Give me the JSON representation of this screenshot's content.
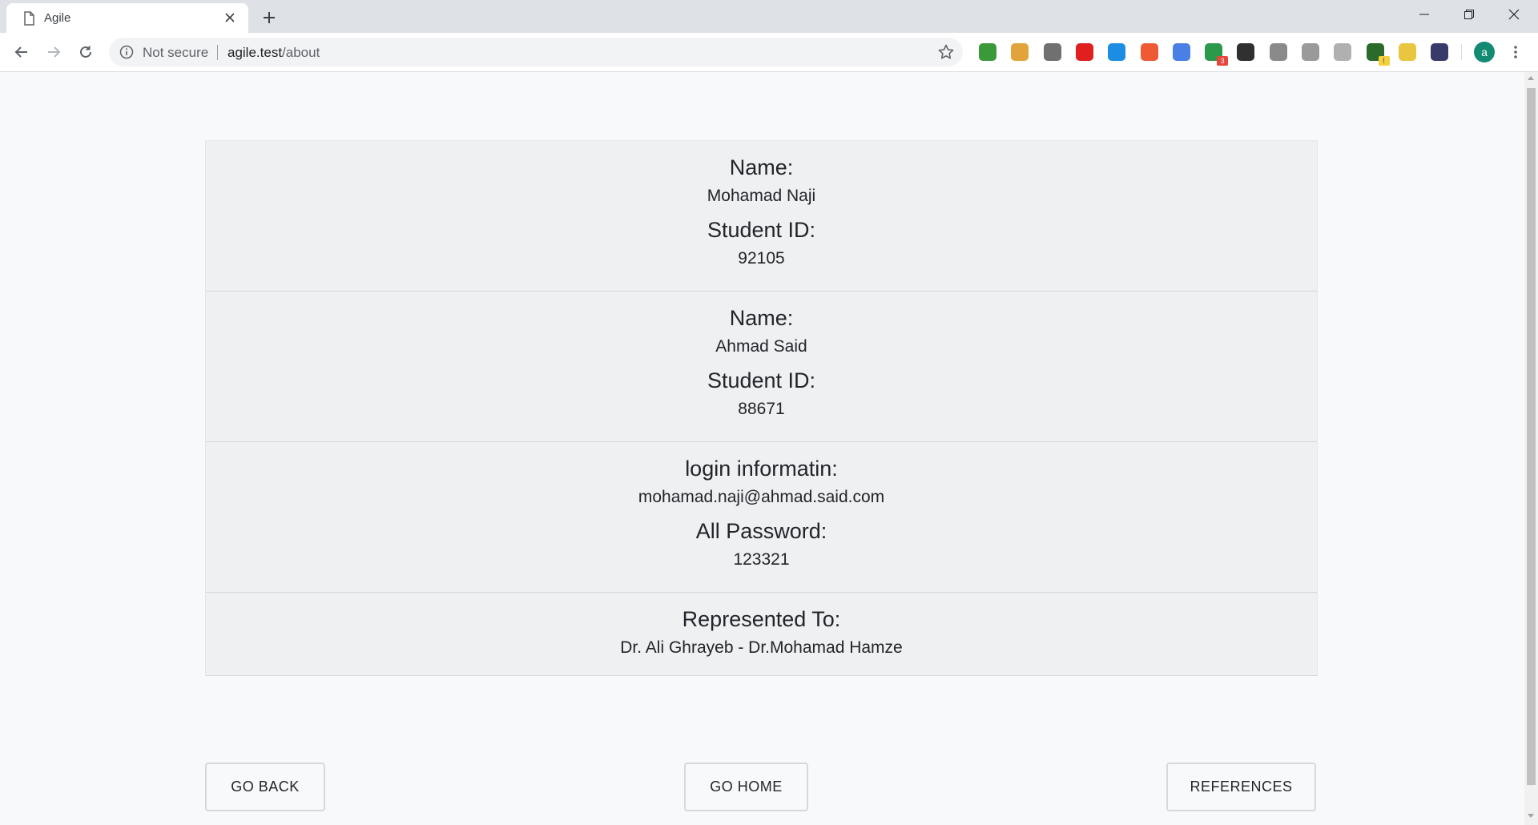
{
  "browser": {
    "tab_title": "Agile",
    "url_security": "Not secure",
    "url_host": "agile.test",
    "url_path": "/about",
    "profile_initial": "a",
    "extensions": [
      {
        "name": "globe-extension-icon",
        "color": "#3a9a3a"
      },
      {
        "name": "wallet-extension-icon",
        "color": "#e2a33a"
      },
      {
        "name": "gamepad-extension-icon",
        "color": "#707070"
      },
      {
        "name": "opera-extension-icon",
        "color": "#e02020"
      },
      {
        "name": "window-extension-icon",
        "color": "#1b8de3"
      },
      {
        "name": "shield-extension-icon",
        "color": "#ef5a34"
      },
      {
        "name": "translate-extension-icon",
        "color": "#4a7fe5"
      },
      {
        "name": "stats-extension-icon",
        "color": "#2a9a4a",
        "badge": "3"
      },
      {
        "name": "qr-code-extension-icon",
        "color": "#303030"
      },
      {
        "name": "v-extension-icon",
        "color": "#8a8a8a"
      },
      {
        "name": "puzzle-extension-icon",
        "color": "#9a9a9a"
      },
      {
        "name": "drive-extension-icon",
        "color": "#b0b0b0"
      },
      {
        "name": "earth-extension-icon",
        "color": "#2a6a2a",
        "badge": "!"
      },
      {
        "name": "leaf-extension-icon",
        "color": "#e8c640"
      },
      {
        "name": "list-extension-icon",
        "color": "#3a3a6a"
      }
    ]
  },
  "sections": {
    "student1": {
      "name_label": "Name:",
      "name_value": "Mohamad Naji",
      "id_label": "Student ID:",
      "id_value": "92105"
    },
    "student2": {
      "name_label": "Name:",
      "name_value": "Ahmad Said",
      "id_label": "Student ID:",
      "id_value": "88671"
    },
    "login": {
      "login_label": "login informatin:",
      "login_value": "mohamad.naji@ahmad.said.com",
      "password_label": "All Password:",
      "password_value": "123321"
    },
    "presented": {
      "label": "Represented To:",
      "value": "Dr. Ali Ghrayeb - Dr.Mohamad Hamze"
    }
  },
  "buttons": {
    "back": "GO BACK",
    "home": "GO HOME",
    "references": "REFERENCES"
  }
}
